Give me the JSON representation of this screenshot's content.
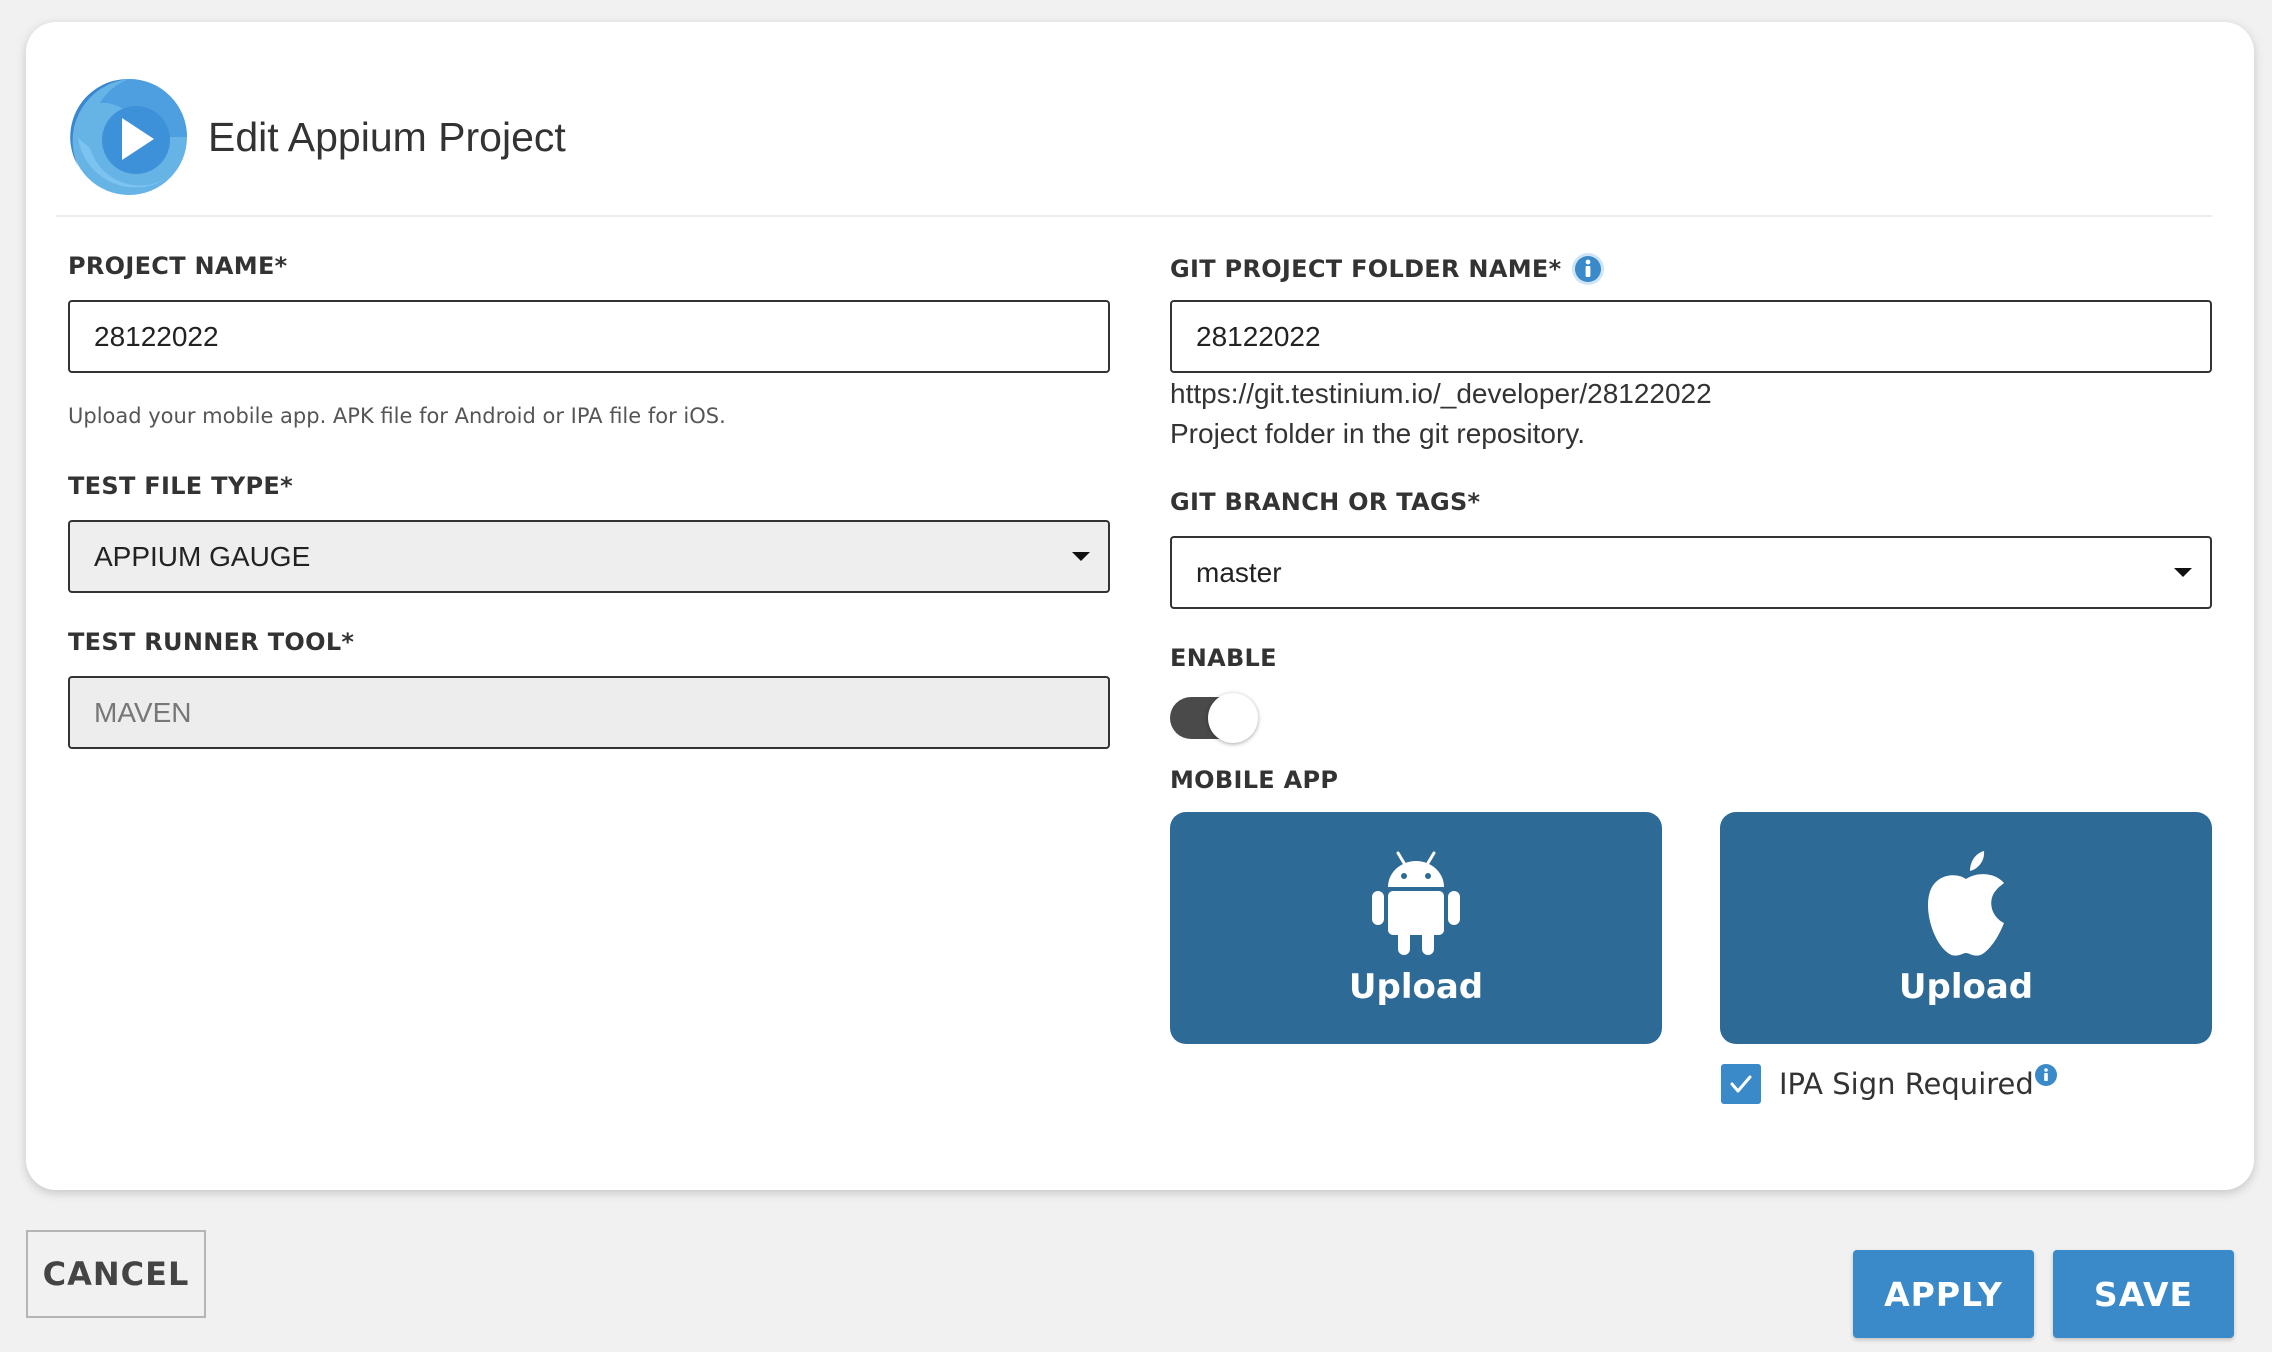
{
  "header": {
    "title": "Edit Appium Project"
  },
  "left": {
    "project_name_label": "PROJECT NAME*",
    "project_name_value": "28122022",
    "upload_hint": "Upload your mobile app. APK file for Android or IPA file for iOS.",
    "test_file_type_label": "TEST FILE TYPE*",
    "test_file_type_value": "APPIUM GAUGE",
    "test_runner_label": "TEST RUNNER TOOL*",
    "test_runner_value": "MAVEN"
  },
  "right": {
    "git_folder_label": "GIT PROJECT FOLDER NAME*",
    "git_folder_value": "28122022",
    "git_url": "https://git.testinium.io/_developer/28122022",
    "git_folder_help": "Project folder in the git repository.",
    "git_branch_label": "GIT BRANCH OR TAGS*",
    "git_branch_value": "master",
    "enable_label": "ENABLE",
    "enable_on": true,
    "mobile_app_label": "MOBILE APP",
    "android_upload_label": "Upload",
    "ios_upload_label": "Upload",
    "ipa_sign_label": "IPA Sign Required",
    "ipa_sign_checked": true
  },
  "footer": {
    "cancel_label": "CANCEL",
    "apply_label": "APPLY",
    "save_label": "SAVE"
  },
  "colors": {
    "accent": "#3a89c9",
    "upload_bg": "#2e6a96",
    "toggle_track": "#4a4a4a"
  },
  "icons": [
    "app-logo-icon",
    "info-icon",
    "dropdown-caret-icon",
    "android-icon",
    "apple-icon",
    "checkmark-icon"
  ]
}
